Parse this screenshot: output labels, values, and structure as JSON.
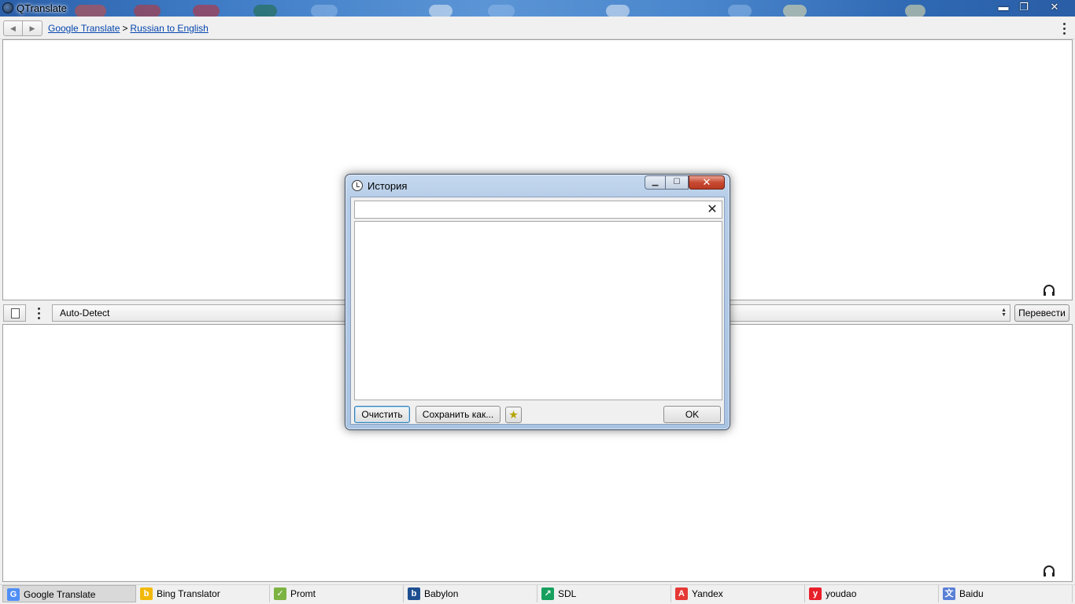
{
  "window": {
    "title": "QTranslate",
    "minimize_glyph": "▬",
    "maximize_glyph": "❐",
    "close_glyph": "✕"
  },
  "toolbar": {
    "back_glyph": "◀",
    "forward_glyph": "▶",
    "breadcrumb": {
      "service": "Google Translate",
      "separator": ">",
      "direction": "Russian to English"
    }
  },
  "source_language": {
    "selected": "Auto-Detect"
  },
  "translate_button": "Перевести",
  "history_dialog": {
    "title": "История",
    "search_value": "",
    "clear_glyph": "✕",
    "buttons": {
      "clear": "Очистить",
      "save_as": "Сохранить как...",
      "favorite_glyph": "★",
      "ok": "OK"
    },
    "items": []
  },
  "service_tabs": [
    {
      "label": "Google Translate",
      "icon": "google-icon",
      "color": "#4f8ef5",
      "glyph": "G",
      "active": true
    },
    {
      "label": "Bing Translator",
      "icon": "bing-icon",
      "color": "#f2b90a",
      "glyph": "b",
      "active": false
    },
    {
      "label": "Promt",
      "icon": "promt-icon",
      "color": "#7cb342",
      "glyph": "✓",
      "active": false
    },
    {
      "label": "Babylon",
      "icon": "babylon-icon",
      "color": "#1d4f91",
      "glyph": "b",
      "active": false
    },
    {
      "label": "SDL",
      "icon": "sdl-icon",
      "color": "#17a05d",
      "glyph": "↗",
      "active": false
    },
    {
      "label": "Yandex",
      "icon": "yandex-icon",
      "color": "#e53935",
      "glyph": "A",
      "active": false
    },
    {
      "label": "youdao",
      "icon": "youdao-icon",
      "color": "#e8202a",
      "glyph": "y",
      "active": false
    },
    {
      "label": "Baidu",
      "icon": "baidu-icon",
      "color": "#5a7fd6",
      "glyph": "文",
      "active": false
    }
  ]
}
